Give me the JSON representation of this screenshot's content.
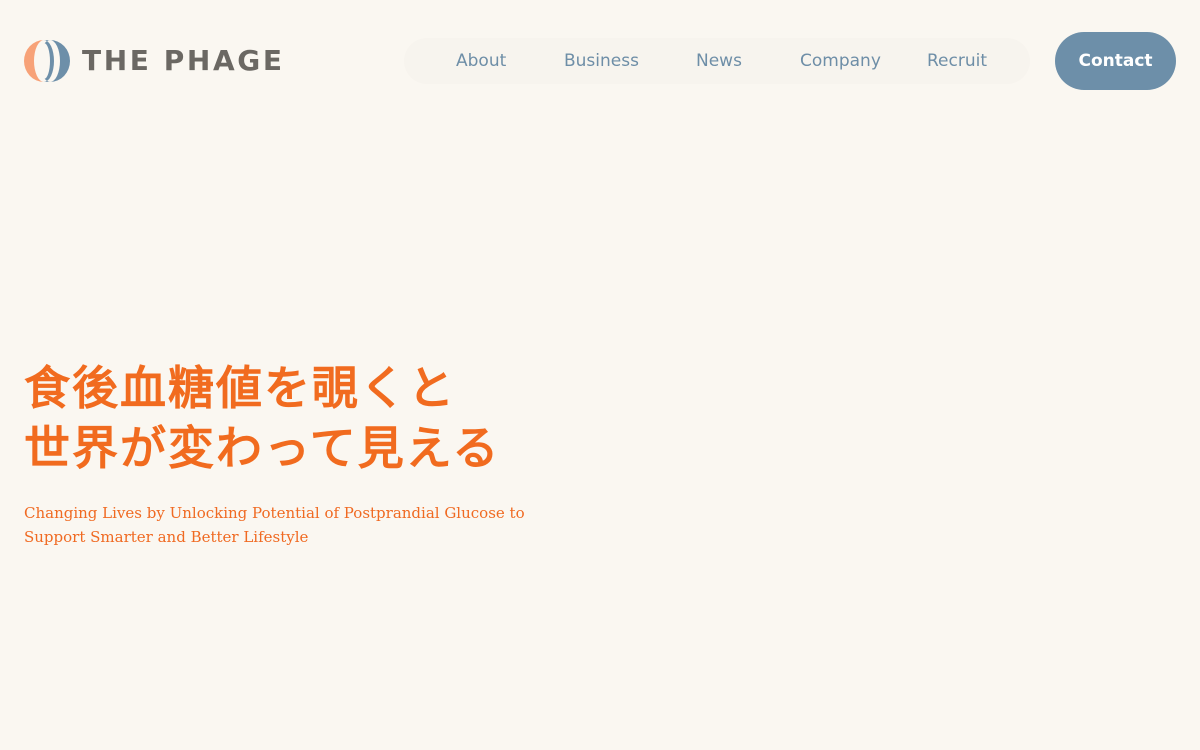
{
  "brand": {
    "name": "THE PHAGE",
    "colors": {
      "logo_left": "#f7a278",
      "logo_right": "#6d8fa9",
      "text": "#6b6863",
      "accent": "#f16b1f",
      "background": "#faf7f1"
    }
  },
  "nav": {
    "items": [
      {
        "label": "About"
      },
      {
        "label": "Business"
      },
      {
        "label": "News"
      },
      {
        "label": "Company"
      },
      {
        "label": "Recruit"
      }
    ],
    "contact_label": "Contact"
  },
  "hero": {
    "heading_line1": "食後血糖値を覗くと",
    "heading_line2": "世界が変わって見える",
    "sub_line1": "Changing Lives by Unlocking Potential of Postprandial Glucose to",
    "sub_line2": "Support Smarter and Better Lifestyle"
  }
}
